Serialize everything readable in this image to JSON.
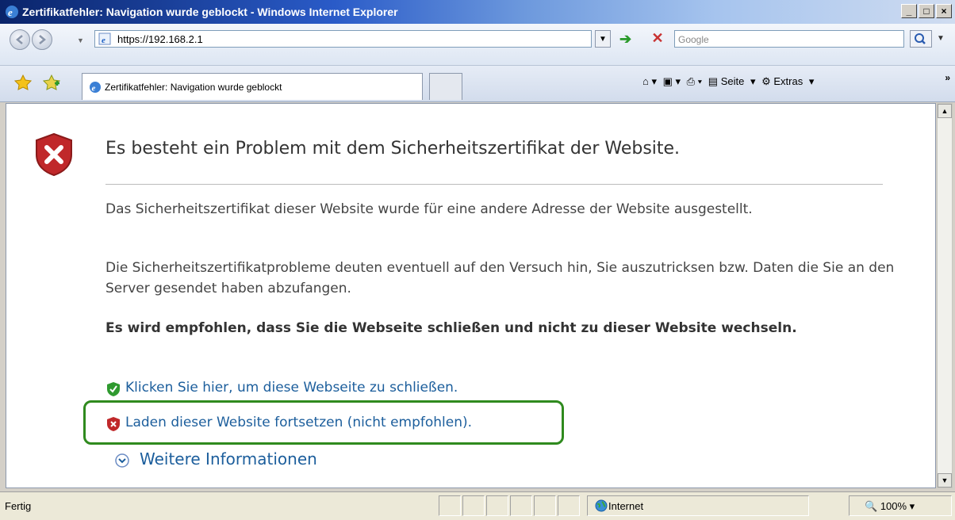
{
  "window": {
    "title": "Zertifikatfehler: Navigation wurde geblockt - Windows Internet Explorer",
    "controls": {
      "minimize": "_",
      "maximize": "□",
      "close": "×"
    }
  },
  "address_bar": {
    "url": "https://192.168.2.1",
    "search_placeholder": "Google"
  },
  "tabs": [
    {
      "label": "Zertifikatfehler: Navigation wurde geblockt",
      "active": true
    }
  ],
  "command_bar": {
    "items": [
      "Seite",
      "Extras"
    ]
  },
  "content": {
    "headline": "Es besteht ein Problem mit dem Sicherheitszertifikat der Website.",
    "para1": "Das Sicherheitszertifikat dieser Website wurde für eine andere Adresse der Website ausgestellt.",
    "para2": "Die Sicherheitszertifikatprobleme deuten eventuell auf den Versuch hin, Sie auszutricksen bzw. Daten die Sie an den Server gesendet haben abzufangen.",
    "recommendation": "Es wird empfohlen, dass Sie die Webseite schließen und nicht zu dieser Website wechseln.",
    "close_link": "Klicken Sie hier, um diese Webseite zu schließen.",
    "continue_link": "Laden dieser Website fortsetzen (nicht empfohlen).",
    "more_info": "Weitere Informationen"
  },
  "status_bar": {
    "status": "Fertig",
    "zone": "Internet",
    "zoom": "100%"
  },
  "colors": {
    "link": "#1c5e9c",
    "highlight": "#2f8a1e",
    "shield_red": "#c0282a",
    "shield_green": "#2f9a2f"
  }
}
